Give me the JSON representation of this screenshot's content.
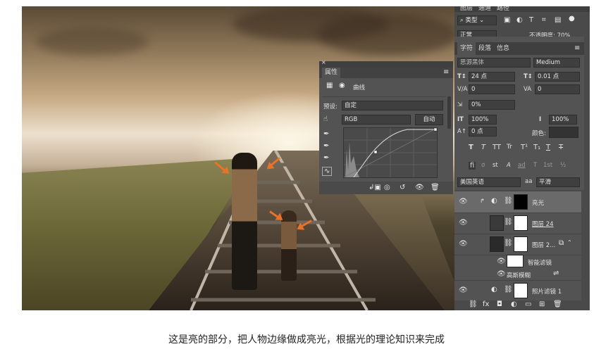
{
  "caption": "这是亮的部分，把人物边缘做成亮光，根据光的理论知识来完成",
  "properties_panel": {
    "title": "属性",
    "type_label": "曲线",
    "preset_label": "预设:",
    "preset_value": "自定",
    "channel_value": "RGB",
    "auto_button": "自动"
  },
  "character_panel": {
    "tabs": [
      "字符",
      "段落",
      "信息"
    ],
    "font_family": "思源黑体",
    "font_style": "Medium",
    "font_size": "24 点",
    "leading": "0.01 点",
    "kerning": "0",
    "tracking": "0",
    "scale_percent": "0%",
    "vertical_scale": "100%",
    "horizontal_scale": "100%",
    "baseline_shift": "0 点",
    "color_label": "颜色:",
    "type_style_buttons": [
      "T",
      "T",
      "TT",
      "Tr",
      "T¹",
      "T₁",
      "T",
      "T"
    ],
    "opentype_buttons": [
      "fi",
      "ơ",
      "st",
      "A",
      "ad",
      "T",
      "1st",
      "½"
    ],
    "language": "美国英语",
    "aa_label": "aa",
    "antialias": "平滑"
  },
  "layers_panel": {
    "top_tabs": [
      "图层",
      "通道",
      "路径"
    ],
    "filter_kind": "类型",
    "blend_mode": "正常",
    "opacity_label": "不透明度: 70%",
    "layers": [
      {
        "name": "亮光",
        "kind": "adjustment"
      },
      {
        "name": "图层 24",
        "kind": "pixel"
      },
      {
        "name": "图层 2...",
        "kind": "smart"
      },
      {
        "name": "智能滤镜",
        "kind": "filter-group"
      },
      {
        "name": "高斯模糊",
        "kind": "filter"
      },
      {
        "name": "照片滤镜 1",
        "kind": "adjustment"
      }
    ]
  },
  "colors": {
    "panel_bg": "#535353",
    "panel_dark": "#3f3f3f",
    "arrow": "#e8722a"
  }
}
